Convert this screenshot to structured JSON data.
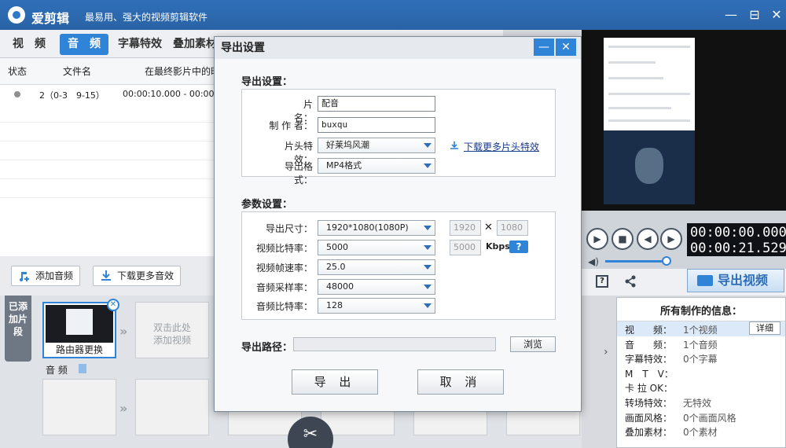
{
  "app": {
    "name": "爱剪辑",
    "slogan": "最易用、强大的视频剪辑软件",
    "window_buttons": [
      "—",
      "⊟",
      "✕"
    ]
  },
  "tabs": [
    "视　频",
    "音　频",
    "字幕特效",
    "叠加素材"
  ],
  "active_tab": "音　频",
  "list": {
    "headers": [
      "状态",
      "文件名",
      "在最终影片中的时"
    ],
    "rows": [
      {
        "name": "2（0-3　9-15）",
        "time": "00:00:10.000 - 00:00"
      }
    ]
  },
  "actions": {
    "add_audio": "添加音频",
    "download_effects": "下载更多音效"
  },
  "timeline": {
    "side_label": "已添加片段",
    "clip_caption": "路由器更换",
    "placeholder_hint": "双击此处\n添加视频",
    "audio_label": "音 频"
  },
  "player": {
    "time_current": "00:00:00.000",
    "time_total": "00:00:21.529"
  },
  "export_video_button": "导出视频",
  "info_panel": {
    "title": "所有制作的信息：",
    "rows": [
      {
        "key": "视　　频：",
        "value": "1个视频",
        "detail": "详细"
      },
      {
        "key": "音　　频：",
        "value": "1个音频"
      },
      {
        "key": "字幕特效：",
        "value": "0个字幕"
      },
      {
        "key": "M　T　V：",
        "value": ""
      },
      {
        "key": "卡 拉 OK：",
        "value": ""
      },
      {
        "key": "转场特效：",
        "value": "无特效"
      },
      {
        "key": "画面风格：",
        "value": "0个画面风格"
      },
      {
        "key": "叠加素材：",
        "value": "0个素材"
      }
    ]
  },
  "dialog": {
    "title": "导出设置",
    "section_export": "导出设置：",
    "section_params": "参数设置：",
    "fields": {
      "name_label": "片　　名：",
      "name_value": "配音",
      "author_label": "制 作 者：",
      "author_value": "buxqu",
      "intro_label": "片头特效：",
      "intro_value": "好莱坞风潮",
      "format_label": "导出格式：",
      "format_value": "MP4格式",
      "download_link": "下载更多片头特效"
    },
    "params": {
      "size_label": "导出尺寸：",
      "size_value": "1920*1080(1080P)",
      "width": "1920",
      "height": "1080",
      "vbitrate_label": "视频比特率：",
      "vbitrate_value": "5000",
      "vbitrate_custom": "5000",
      "kbps": "Kbps",
      "help": "?",
      "framerate_label": "视频帧速率：",
      "framerate_value": "25.0",
      "samplerate_label": "音频采样率：",
      "samplerate_value": "48000",
      "abitrate_label": "音频比特率：",
      "abitrate_value": "128"
    },
    "path_label": "导出路径：",
    "browse": "浏览",
    "export_btn": "导 出",
    "cancel_btn": "取 消",
    "times_sign": "✕"
  }
}
